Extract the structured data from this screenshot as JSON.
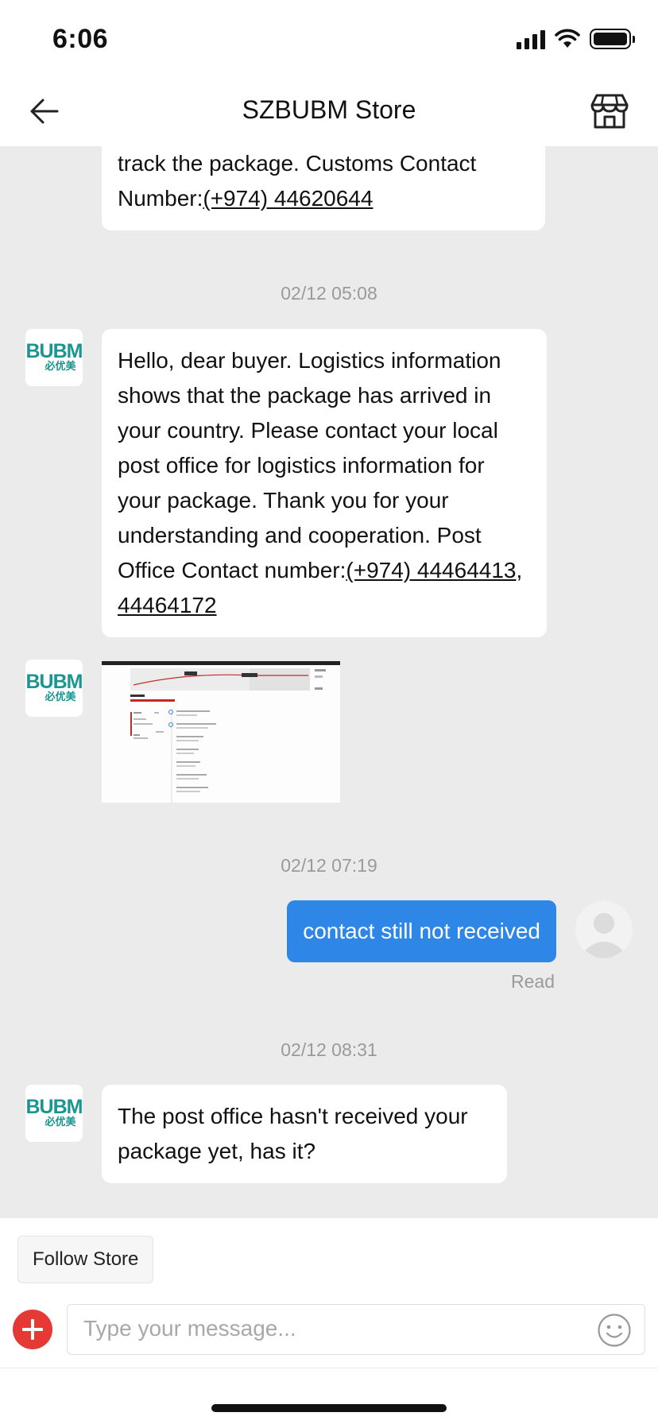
{
  "status_bar": {
    "time": "6:06"
  },
  "header": {
    "title": "SZBUBM Store"
  },
  "store_logo": {
    "line1": "BUBM",
    "line2": "必优美"
  },
  "messages": {
    "partial": {
      "text": "track the package. Customs Contact Number:",
      "phone": "(+974) 44620644"
    },
    "msg1": {
      "timestamp": "02/12 05:08",
      "text": "Hello, dear buyer. Logistics information shows that the package has arrived in your country. Please contact your local post office for logistics information for your package. Thank you for your understanding and cooperation. Post Office Contact number:",
      "phone1": "(+974) 44464413",
      "separator": ", ",
      "phone2": "44464172"
    },
    "msg2": {
      "timestamp": "02/12 07:19",
      "text": "contact still not received",
      "status": "Read"
    },
    "msg3": {
      "timestamp": "02/12 08:31",
      "text": "The post office hasn't received your package yet, has it?"
    }
  },
  "footer": {
    "follow_label": "Follow Store",
    "input_placeholder": "Type your message..."
  },
  "colors": {
    "accent": "#2e86e6",
    "brand_green": "#18968f",
    "add_button": "#e53935",
    "chat_background": "#ebebeb"
  },
  "icons": [
    "back-arrow-icon",
    "store-icon",
    "plus-icon",
    "emoji-icon",
    "signal-icon",
    "wifi-icon",
    "battery-icon"
  ]
}
